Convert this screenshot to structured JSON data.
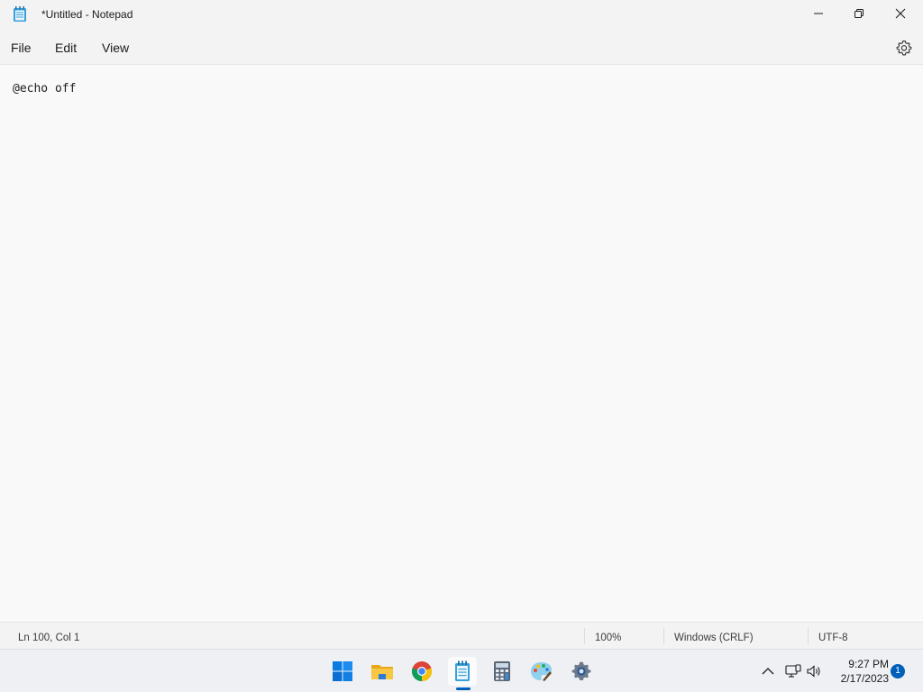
{
  "window": {
    "title": "*Untitled - Notepad",
    "app_icon": "notepad-icon"
  },
  "menu": {
    "items": [
      {
        "label": "File"
      },
      {
        "label": "Edit"
      },
      {
        "label": "View"
      }
    ],
    "settings_icon": "gear-icon"
  },
  "editor": {
    "content": "@echo off"
  },
  "status": {
    "position": "Ln 100, Col 1",
    "zoom": "100%",
    "line_ending": "Windows (CRLF)",
    "encoding": "UTF-8"
  },
  "taskbar": {
    "apps": [
      {
        "name": "start-icon",
        "active": false
      },
      {
        "name": "file-explorer-icon",
        "active": false
      },
      {
        "name": "chrome-icon",
        "active": false
      },
      {
        "name": "notepad-icon",
        "active": true
      },
      {
        "name": "calculator-icon",
        "active": false
      },
      {
        "name": "paint-icon",
        "active": false
      },
      {
        "name": "settings-icon",
        "active": false
      }
    ],
    "tray": {
      "time": "9:27 PM",
      "date": "2/17/2023",
      "notifications": "1"
    }
  },
  "colors": {
    "accent": "#005fb8",
    "editor_bg": "#f9f9f9",
    "chrome_bg": "#f3f3f3"
  }
}
